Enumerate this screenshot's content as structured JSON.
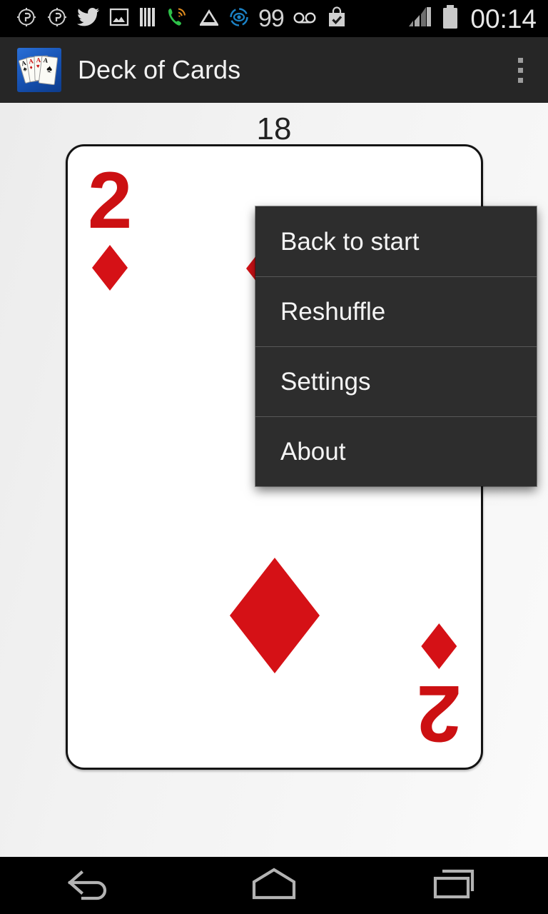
{
  "status_bar": {
    "icons": [
      {
        "name": "app-circle-icon-1",
        "glyph": "circle-person"
      },
      {
        "name": "app-circle-icon-2",
        "glyph": "circle-person"
      },
      {
        "name": "twitter-icon",
        "glyph": "bird"
      },
      {
        "name": "photo-icon",
        "glyph": "picture-frame"
      },
      {
        "name": "barcode-icon",
        "glyph": "bars"
      },
      {
        "name": "phone-signal-icon",
        "glyph": "phone-waves"
      },
      {
        "name": "inbox-icon",
        "glyph": "envelope-tray"
      },
      {
        "name": "eye-target-icon",
        "glyph": "eye-circle"
      },
      {
        "name": "notification-count",
        "glyph": "text"
      },
      {
        "name": "voicemail-icon",
        "glyph": "double-circle"
      },
      {
        "name": "shopping-bag-check-icon",
        "glyph": "bag-check"
      }
    ],
    "notification_count": "99",
    "signal_label": "signal-bars",
    "battery_label": "battery-full",
    "clock": "00:14"
  },
  "action_bar": {
    "title": "Deck of Cards",
    "app_icon_name": "deck-of-cards-app-icon",
    "overflow_label": "more-options"
  },
  "content": {
    "counter": "18",
    "card": {
      "rank": "2",
      "suit": "diamonds",
      "suit_symbol": "♦",
      "color": "#d51116"
    }
  },
  "overflow_menu": {
    "items": [
      {
        "label": "Back to start"
      },
      {
        "label": "Reshuffle"
      },
      {
        "label": "Settings"
      },
      {
        "label": "About"
      }
    ]
  },
  "nav_bar": {
    "back_label": "back",
    "home_label": "home",
    "recents_label": "recent-apps"
  },
  "colors": {
    "action_bar_bg": "#262626",
    "menu_bg": "#2d2d2d",
    "card_red": "#d51116",
    "content_bg": "#f2f2f2"
  }
}
